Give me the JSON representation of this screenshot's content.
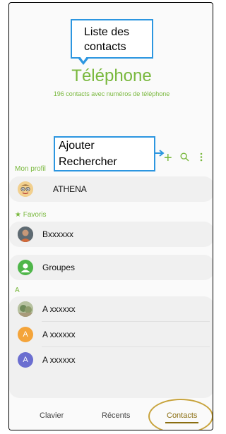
{
  "annotations": {
    "top_callout": [
      "Liste des",
      "contacts"
    ],
    "mid_callout": [
      "Ajouter",
      "Rechercher"
    ]
  },
  "header": {
    "title": "Téléphone",
    "subtitle": "196 contacts avec numéros de téléphone"
  },
  "actions": {
    "add_icon": "+",
    "search_icon": "search-icon",
    "more_icon": "more-vertical-icon"
  },
  "sections": {
    "my_profile": "Mon profil",
    "favorites": "★ Favoris",
    "letter_a": "A"
  },
  "profile": {
    "name": "ATHENA",
    "avatar": "cartoon-avatar"
  },
  "favorites": [
    {
      "name": "Bxxxxxx",
      "avatar": "photo"
    }
  ],
  "groups": {
    "label": "Groupes",
    "icon": "person-icon"
  },
  "contacts_a": [
    {
      "name": "A xxxxxx",
      "avatar": "photo",
      "color": "#9aa57a"
    },
    {
      "name": "A xxxxxx",
      "avatar_letter": "A",
      "color": "#f4a43a"
    },
    {
      "name": "A xxxxxx",
      "avatar_letter": "A",
      "color": "#6b6ed0"
    }
  ],
  "bottom_tabs": {
    "keypad": "Clavier",
    "recents": "Récents",
    "contacts": "Contacts"
  },
  "colors": {
    "accent": "#79b83d",
    "annotation_blue": "#2c96e0",
    "highlight_gold": "#c8a43e"
  }
}
